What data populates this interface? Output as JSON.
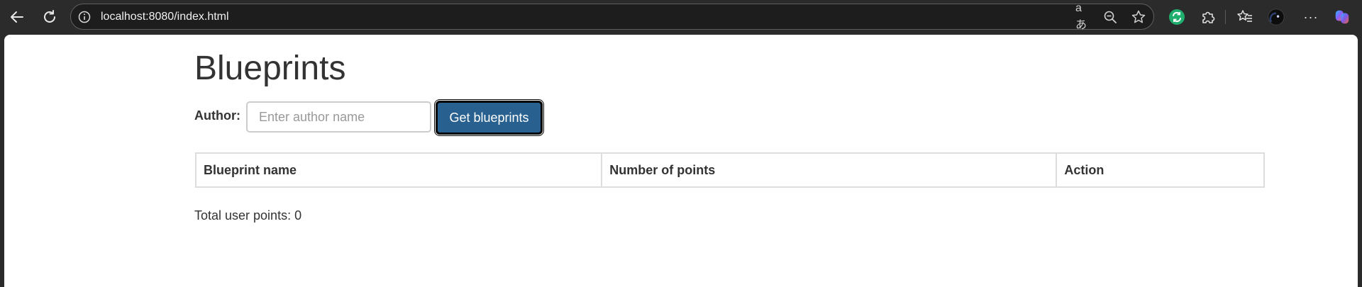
{
  "browser": {
    "url": "localhost:8080/index.html",
    "icons": {
      "back": "back-arrow-icon",
      "reload": "reload-icon",
      "site_info": "info-icon",
      "read_aloud": "read-aloud-icon",
      "zoom": "zoom-out-icon",
      "favorite": "star-icon",
      "extension_green": "extension-icon",
      "extensions": "puzzle-icon",
      "favorites": "favorites-icon",
      "profile": "profile-avatar",
      "more": "more-icon",
      "copilot": "copilot-icon"
    },
    "read_aloud_glyph": "aあ",
    "more_glyph": "···"
  },
  "page": {
    "title": "Blueprints",
    "author_label": "Author:",
    "author_input": {
      "value": "",
      "placeholder": "Enter author name"
    },
    "get_button_label": "Get blueprints",
    "accent_color": "#286090",
    "table": {
      "headers": [
        "Blueprint name",
        "Number of points",
        "Action"
      ],
      "rows": []
    },
    "total_prefix": "Total user points:",
    "total_value": "0"
  }
}
